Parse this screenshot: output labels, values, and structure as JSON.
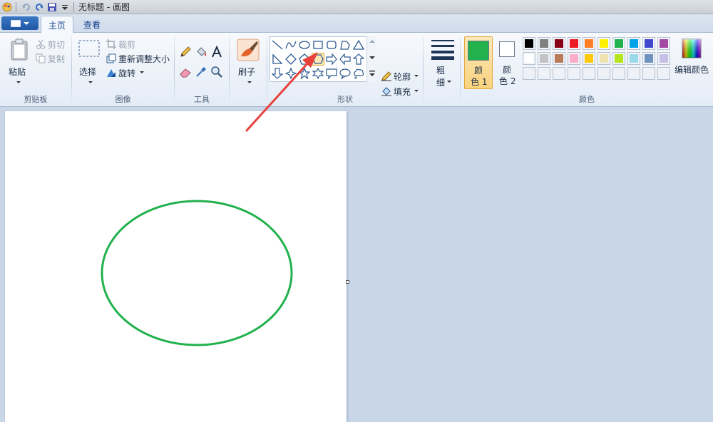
{
  "title_bar": {
    "title": "无标题 - 画图"
  },
  "tabs": [
    {
      "label": "主页"
    },
    {
      "label": "查看"
    }
  ],
  "clipboard": {
    "paste": "粘贴",
    "cut": "剪切",
    "copy": "复制",
    "group": "剪贴板"
  },
  "image": {
    "select": "选择",
    "crop": "裁剪",
    "resize": "重新调整大小",
    "rotate": "旋转",
    "group": "图像"
  },
  "tools": {
    "group": "工具"
  },
  "brushes": {
    "label": "刷子"
  },
  "shapes": {
    "outline": "轮廓",
    "fill": "填充",
    "group": "形状"
  },
  "size": {
    "label1": "粗",
    "label2": "细"
  },
  "colors": {
    "color1_l1": "颜",
    "color1_l2": "色 1",
    "color2_l1": "颜",
    "color2_l2": "色 2",
    "edit": "编辑颜色",
    "group": "颜色",
    "color1_value": "#22b14c",
    "color2_value": "#ffffff",
    "palette_row1": [
      "#000000",
      "#7f7f7f",
      "#880015",
      "#ed1c24",
      "#ff7f27",
      "#fff200",
      "#22b14c",
      "#00a2e8",
      "#3f48cc",
      "#a349a4"
    ],
    "palette_row2": [
      "#ffffff",
      "#c3c3c3",
      "#b97a57",
      "#ffaec9",
      "#ffc90e",
      "#efe4b0",
      "#b5e61d",
      "#99d9ea",
      "#7092be",
      "#c8bfe7"
    ]
  },
  "canvas": {
    "ellipse_color": "#22b14c",
    "annotation_arrow_color": "#e8413c"
  }
}
